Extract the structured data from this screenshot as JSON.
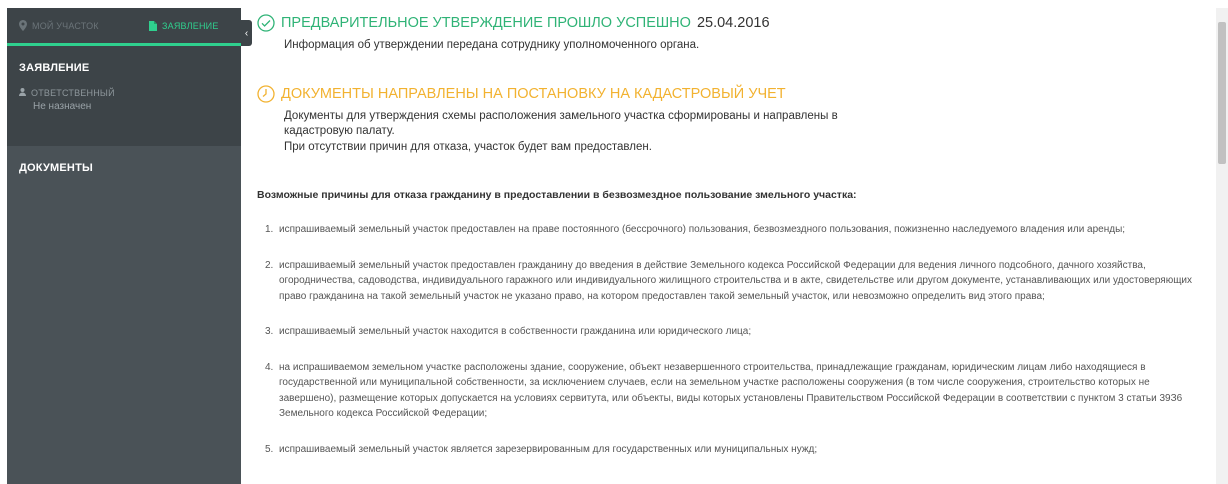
{
  "sidebar": {
    "tabs": [
      {
        "label": "мой участок",
        "icon": "map-pin-icon"
      },
      {
        "label": "заявление",
        "icon": "document-icon"
      }
    ],
    "collapse_icon": "chevron-left-icon",
    "application_section": {
      "title": "ЗАЯВЛЕНИЕ",
      "responsible_label": "ответственный",
      "responsible_value": "Не назначен",
      "responsible_icon": "user-icon"
    },
    "documents_section": {
      "title": "ДОКУМЕНТЫ"
    }
  },
  "main": {
    "status1": {
      "icon": "check-circle-icon",
      "title": "ПРЕДВАРИТЕЛЬНОЕ УТВЕРЖДЕНИЕ ПРОШЛО УСПЕШНО",
      "date": "25.04.2016",
      "text": "Информация об утверждении передана сотруднику уполномоченного органа."
    },
    "status2": {
      "icon": "clock-icon",
      "title": "ДОКУМЕНТЫ НАПРАВЛЕНЫ НА ПОСТАНОВКУ НА КАДАСТРОВЫЙ УЧЕТ",
      "text_line1": "Документы для утверждения схемы расположения замельного участка сформированы и направлены в кадастровую палату.",
      "text_line2": "При отсутствии причин для отказа, участок будет вам предоставлен."
    },
    "reasons_title": "Возможные причины для отказа гражданину в предоставлении в безвозмездное пользование змельного участка:",
    "reasons": [
      {
        "num": "1.",
        "text": "испрашиваемый земельный участок предоставлен на праве постоянного (бессрочного) пользования, безвозмездного пользования, пожизненно наследуемого владения или аренды;"
      },
      {
        "num": "2.",
        "text": "испрашиваемый земельный участок предоставлен гражданину до введения в действие Земельного кодекса Российской Федерации для ведения личного подсобного, дачного хозяйства, огородничества, садоводства, индивидуального гаражного или индивидуального жилищного строительства и в акте, свидетельстве или другом документе, устанавливающих или удостоверяющих право гражданина на такой земельный участок не указано право, на котором предоставлен такой земельный участок, или невозможно определить вид этого права;"
      },
      {
        "num": "3.",
        "text": "испрашиваемый земельный участок находится в собственности гражданина или юридического лица;"
      },
      {
        "num": "4.",
        "text": "на испрашиваемом земельном участке расположены здание, сооружение, объект незавершенного строительства, принадлежащие гражданам, юридическим лицам либо находящиеся в государственной или муниципальной собственности, за исключением случаев, если на земельном участке расположены сооружения (в том числе сооружения, строительство которых не завершено), размещение которых допускается на условиях сервитута, или объекты, виды которых установлены Правительством Российской Федерации в соответствии с пунктом 3 статьи 39З6 Земельного кодекса Российской Федерации;"
      },
      {
        "num": "5.",
        "text": "испрашиваемый земельный участок является зарезервированным для государственных или муниципальных нужд;"
      }
    ]
  },
  "colors": {
    "accent_green": "#2fd08e",
    "status_green": "#2fb376",
    "status_yellow": "#f2b230",
    "sidebar_bg": "#4a5257",
    "sidebar_dark": "#3d4448"
  }
}
